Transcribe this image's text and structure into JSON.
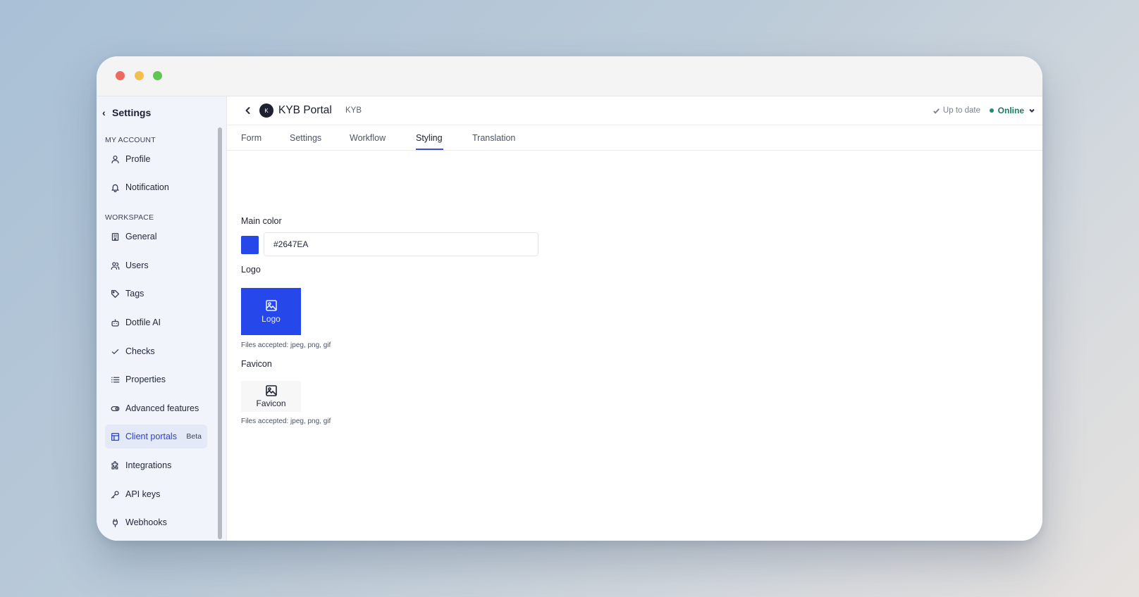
{
  "sidebar": {
    "back_label": "Settings",
    "sections": {
      "my_account": "MY ACCOUNT",
      "workspace": "WORKSPACE"
    },
    "items": [
      {
        "label": "Profile",
        "icon": "user-icon"
      },
      {
        "label": "Notification",
        "icon": "bell-icon"
      },
      {
        "label": "General",
        "icon": "building-icon"
      },
      {
        "label": "Users",
        "icon": "users-icon"
      },
      {
        "label": "Tags",
        "icon": "tag-icon"
      },
      {
        "label": "Dotfile AI",
        "icon": "bot-icon"
      },
      {
        "label": "Checks",
        "icon": "check-icon"
      },
      {
        "label": "Properties",
        "icon": "list-icon"
      },
      {
        "label": "Advanced features",
        "icon": "toggle-icon"
      },
      {
        "label": "Client portals",
        "icon": "layout-icon",
        "badge": "Beta",
        "active": true
      },
      {
        "label": "Integrations",
        "icon": "puzzle-icon"
      },
      {
        "label": "API keys",
        "icon": "key-icon"
      },
      {
        "label": "Webhooks",
        "icon": "webhook-icon"
      }
    ]
  },
  "header": {
    "avatar_initial": "K",
    "title": "KYB Portal",
    "tag": "KYB",
    "sync_status": "Up to date",
    "online_status": "Online"
  },
  "tabs": [
    "Form",
    "Settings",
    "Workflow",
    "Styling",
    "Translation"
  ],
  "active_tab": "Styling",
  "styling": {
    "main_color_label": "Main color",
    "main_color_value": "#2647EA",
    "logo_label": "Logo",
    "logo_button": "Logo",
    "logo_hint": "Files accepted: jpeg, png, gif",
    "favicon_label": "Favicon",
    "favicon_button": "Favicon",
    "favicon_hint": "Files accepted: jpeg, png, gif"
  },
  "colors": {
    "accent": "#2647EA",
    "active_nav": "#2B43C9",
    "online": "#1A7A63"
  }
}
